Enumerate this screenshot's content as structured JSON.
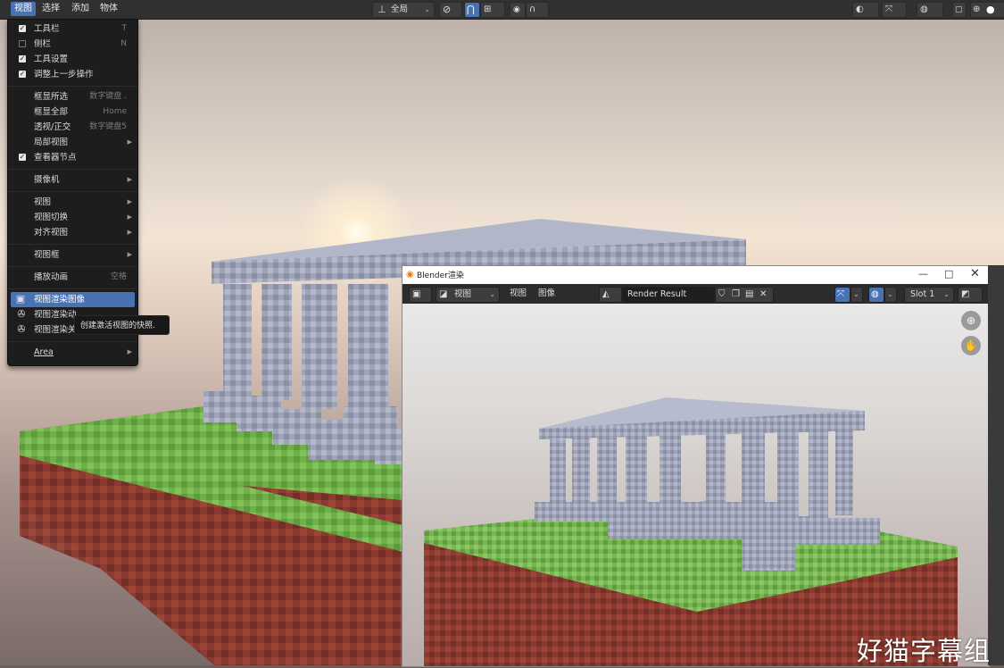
{
  "header": {
    "menus": [
      "视图",
      "选择",
      "添加",
      "物体"
    ],
    "transform_orientation": "全局"
  },
  "view_menu": {
    "items": [
      {
        "label": "工具栏",
        "check": true,
        "shortcut": "T"
      },
      {
        "label": "侧栏",
        "check": false,
        "shortcut": "N"
      },
      {
        "label": "工具设置",
        "check": true,
        "shortcut": ""
      },
      {
        "label": "调整上一步操作",
        "check": true,
        "shortcut": ""
      },
      {
        "label": "框显所选",
        "shortcut": "数字键盘 ."
      },
      {
        "label": "框显全部",
        "shortcut": "Home"
      },
      {
        "label": "透视/正交",
        "shortcut": "数字键盘5"
      },
      {
        "label": "局部视图",
        "submenu": true
      },
      {
        "label": "查看器节点",
        "check": true
      },
      {
        "label": "摄像机",
        "submenu": true
      },
      {
        "label": "视图",
        "submenu": true
      },
      {
        "label": "视图切换",
        "submenu": true
      },
      {
        "label": "对齐视图",
        "submenu": true
      },
      {
        "label": "视图框",
        "submenu": true
      },
      {
        "label": "播放动画",
        "shortcut": "空格"
      },
      {
        "label": "视图渲染图像",
        "highlighted": true
      },
      {
        "label": "视图渲染动"
      },
      {
        "label": "视图渲染关"
      },
      {
        "label": "Area",
        "submenu": true
      }
    ],
    "tooltip": "创建激活视图的快照."
  },
  "render_window": {
    "title": "Blender渲染",
    "view_label": "视图",
    "menu_view": "视图",
    "menu_image": "图像",
    "image_name": "Render Result",
    "slot": "Slot 1"
  },
  "watermark": "好猫字幕组",
  "colors": {
    "accent": "#4772b3",
    "header_bg": "#303030",
    "menu_bg": "#1d1d1d"
  }
}
